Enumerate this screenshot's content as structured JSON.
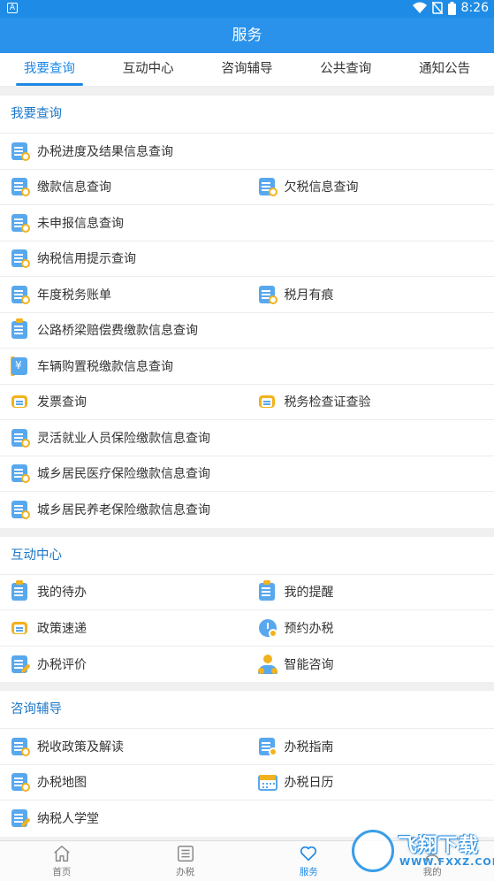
{
  "status": {
    "badge": "A",
    "time": "8:26"
  },
  "header": {
    "title": "服务"
  },
  "tabs": [
    {
      "label": "我要查询",
      "active": true
    },
    {
      "label": "互动中心",
      "active": false
    },
    {
      "label": "咨询辅导",
      "active": false
    },
    {
      "label": "公共查询",
      "active": false
    },
    {
      "label": "通知公告",
      "active": false
    }
  ],
  "sections": {
    "query": {
      "title": "我要查询",
      "items": [
        "办税进度及结果信息查询",
        "缴款信息查询",
        "欠税信息查询",
        "未申报信息查询",
        "纳税信用提示查询",
        "年度税务账单",
        "税月有痕",
        "公路桥梁赔偿费缴款信息查询",
        "车辆购置税缴款信息查询",
        "发票查询",
        "税务检查证查验",
        "灵活就业人员保险缴款信息查询",
        "城乡居民医疗保险缴款信息查询",
        "城乡居民养老保险缴款信息查询"
      ]
    },
    "interact": {
      "title": "互动中心",
      "items": [
        "我的待办",
        "我的提醒",
        "政策速递",
        "预约办税",
        "办税评价",
        "智能咨询"
      ]
    },
    "consult": {
      "title": "咨询辅导",
      "items": [
        "税收政策及解读",
        "办税指南",
        "办税地图",
        "办税日历",
        "纳税人学堂"
      ]
    }
  },
  "bottomnav": [
    {
      "label": "首页",
      "icon": "home-icon"
    },
    {
      "label": "办税",
      "icon": "list-icon"
    },
    {
      "label": "服务",
      "icon": "heart-icon",
      "active": true
    },
    {
      "label": "我的",
      "icon": "user-icon"
    }
  ],
  "watermark": {
    "text": "飞翔下载",
    "url": "WWW.FXXZ.COM"
  },
  "colors": {
    "primary": "#2a92ea",
    "accent": "#1e88e5",
    "icon_blue": "#58a8ee",
    "icon_yellow": "#f2b21d"
  }
}
